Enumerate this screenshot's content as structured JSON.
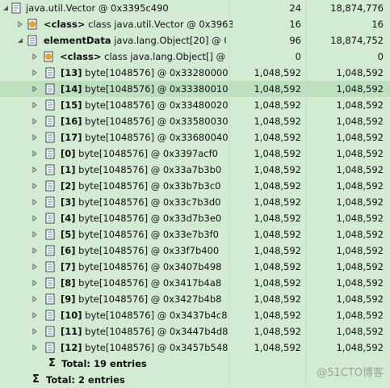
{
  "rows": [
    {
      "name": "java.util.Vector @ 0x3395c490",
      "col2": "24",
      "col3": "18,874,776"
    },
    {
      "tag": "<class>",
      "name": " class java.util.Vector @ 0x3963",
      "col2": "16",
      "col3": "16"
    },
    {
      "bold": "elementData",
      "name": " java.lang.Object[20] @ 0x",
      "col2": "96",
      "col3": "18,874,752"
    },
    {
      "tag": "<class>",
      "name": " class java.lang.Object[] @ 0",
      "col2": "0",
      "col3": "0"
    },
    {
      "bold": "[13]",
      "name": " byte[1048576] @ 0x33280000",
      "col2": "1,048,592",
      "col3": "1,048,592"
    },
    {
      "bold": "[14]",
      "name": " byte[1048576] @ 0x33380010",
      "col2": "1,048,592",
      "col3": "1,048,592"
    },
    {
      "bold": "[15]",
      "name": " byte[1048576] @ 0x33480020",
      "col2": "1,048,592",
      "col3": "1,048,592"
    },
    {
      "bold": "[16]",
      "name": " byte[1048576] @ 0x33580030",
      "col2": "1,048,592",
      "col3": "1,048,592"
    },
    {
      "bold": "[17]",
      "name": " byte[1048576] @ 0x33680040",
      "col2": "1,048,592",
      "col3": "1,048,592"
    },
    {
      "bold": "[0]",
      "name": " byte[1048576] @ 0x3397acf0",
      "col2": "1,048,592",
      "col3": "1,048,592"
    },
    {
      "bold": "[1]",
      "name": " byte[1048576] @ 0x33a7b3b0",
      "col2": "1,048,592",
      "col3": "1,048,592"
    },
    {
      "bold": "[2]",
      "name": " byte[1048576] @ 0x33b7b3c0",
      "col2": "1,048,592",
      "col3": "1,048,592"
    },
    {
      "bold": "[3]",
      "name": " byte[1048576] @ 0x33c7b3d0",
      "col2": "1,048,592",
      "col3": "1,048,592"
    },
    {
      "bold": "[4]",
      "name": " byte[1048576] @ 0x33d7b3e0",
      "col2": "1,048,592",
      "col3": "1,048,592"
    },
    {
      "bold": "[5]",
      "name": " byte[1048576] @ 0x33e7b3f0",
      "col2": "1,048,592",
      "col3": "1,048,592"
    },
    {
      "bold": "[6]",
      "name": " byte[1048576] @ 0x33f7b400",
      "col2": "1,048,592",
      "col3": "1,048,592"
    },
    {
      "bold": "[7]",
      "name": " byte[1048576] @ 0x3407b498",
      "col2": "1,048,592",
      "col3": "1,048,592"
    },
    {
      "bold": "[8]",
      "name": " byte[1048576] @ 0x3417b4a8",
      "col2": "1,048,592",
      "col3": "1,048,592"
    },
    {
      "bold": "[9]",
      "name": " byte[1048576] @ 0x3427b4b8",
      "col2": "1,048,592",
      "col3": "1,048,592"
    },
    {
      "bold": "[10]",
      "name": " byte[1048576] @ 0x3437b4c8",
      "col2": "1,048,592",
      "col3": "1,048,592"
    },
    {
      "bold": "[11]",
      "name": " byte[1048576] @ 0x3447b4d8",
      "col2": "1,048,592",
      "col3": "1,048,592"
    },
    {
      "bold": "[12]",
      "name": " byte[1048576] @ 0x3457b548",
      "col2": "1,048,592",
      "col3": "1,048,592"
    }
  ],
  "totals": {
    "inner": "Total: 19 entries",
    "outer": "Total: 2 entries"
  },
  "icons": {
    "object": "object-icon",
    "class": "class-icon",
    "array": "array-icon",
    "sigma": "Σ"
  },
  "watermark": "@51CTO博客",
  "colors": {
    "background": "#d3ebd3",
    "selected_row": "#bfe0bf",
    "icon_orange": "#e8a23a"
  }
}
